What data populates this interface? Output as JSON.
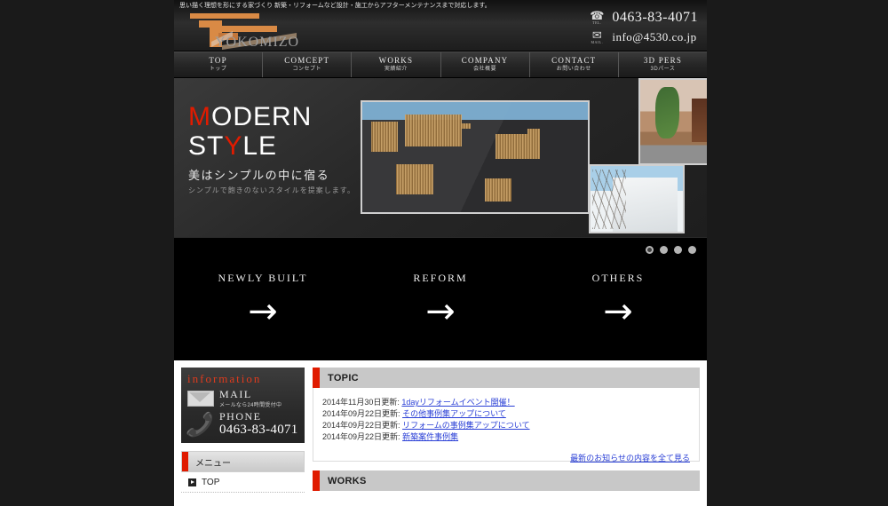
{
  "header": {
    "tagline": "思い描く理想を形にする家づくり 新築・リフォームなど設計・施工からアフターメンテナンスまで対応します。",
    "logo_text": "YOKOMIZO",
    "tel_label": "TEL.",
    "tel_value": "0463-83-4071",
    "mail_label": "MAIL.",
    "mail_value": "info@4530.co.jp",
    "tel_icon": "telephone-icon",
    "mail_icon": "envelope-icon"
  },
  "nav": {
    "items": [
      {
        "en": "TOP",
        "jp": "トップ"
      },
      {
        "en": "COMCEPT",
        "jp": "コンセプト"
      },
      {
        "en": "WORKS",
        "jp": "実績紹介"
      },
      {
        "en": "COMPANY",
        "jp": "会社概要"
      },
      {
        "en": "CONTACT",
        "jp": "お問い合わせ"
      },
      {
        "en": "3D PERS",
        "jp": "3Dパース"
      }
    ]
  },
  "hero": {
    "title_line1_accent": "M",
    "title_line1_rest": "ODERN",
    "title_line2_pre": "ST",
    "title_line2_accent": "Y",
    "title_line2_post": "LE",
    "subtitle": "美はシンプルの中に宿る",
    "caption": "シンプルで飽きのないスタイルを提案します。",
    "photos": [
      {
        "name": "modern-black-house-photo"
      },
      {
        "name": "brick-entrance-photo"
      },
      {
        "name": "white-house-photo"
      }
    ]
  },
  "carousel": {
    "dots": [
      {
        "active": true
      },
      {
        "active": false
      },
      {
        "active": false
      },
      {
        "active": false
      }
    ]
  },
  "categories": {
    "items": [
      {
        "label": "NEWLY BUILT",
        "arrow": "→"
      },
      {
        "label": "REFORM",
        "arrow": "→"
      },
      {
        "label": "OTHERS",
        "arrow": "→"
      }
    ]
  },
  "sidebar": {
    "info": {
      "title": "information",
      "mail_label": "MAIL",
      "mail_note": "メールなら24時間受付中",
      "phone_label": "PHONE",
      "phone_value": "0463-83-4071"
    },
    "menu_header": "メニュー",
    "menu_items": [
      {
        "label": "TOP"
      }
    ]
  },
  "main": {
    "topic": {
      "title": "TOPIC",
      "rows": [
        {
          "date": "2014年11月30日更新:",
          "link": "1dayリフォームイベント開催！"
        },
        {
          "date": "2014年09月22日更新:",
          "link": "その他事例集アップについて"
        },
        {
          "date": "2014年09月22日更新:",
          "link": "リフォームの事例集アップについて"
        },
        {
          "date": "2014年09月22日更新:",
          "link": "新築案件事例集"
        }
      ],
      "more_link": "最新のお知らせの内容を全て見る"
    },
    "works": {
      "title": "WORKS"
    }
  },
  "colors": {
    "accent_red": "#e01b00",
    "link_blue": "#2a3fd6",
    "page_bg": "#1a1a1a",
    "logo_orange": "#d98a45"
  }
}
